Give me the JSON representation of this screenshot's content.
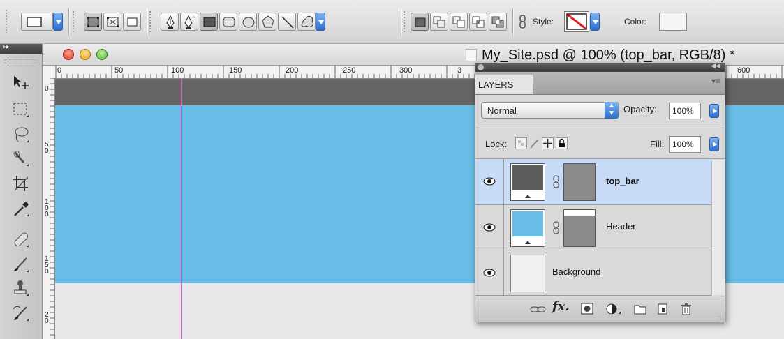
{
  "options_bar": {
    "style_label": "Style:",
    "color_label": "Color:",
    "icons": [
      "rectangle-tool-preset",
      "shape-layers-mode",
      "paths-mode",
      "fill-pixels-mode",
      "pen-tool",
      "freeform-pen-tool",
      "rectangle-shape",
      "rounded-rectangle-shape",
      "ellipse-shape",
      "polygon-shape",
      "line-shape",
      "custom-shape",
      "new-layer",
      "add-to-shape",
      "subtract-shape",
      "intersect-shape",
      "exclude-shape",
      "link-style",
      "style-none-swatch",
      "color-swatch"
    ]
  },
  "tools": [
    "move-tool",
    "marquee-tool",
    "lasso-tool",
    "quick-selection-tool",
    "crop-tool",
    "eyedropper-tool",
    "healing-brush-tool",
    "brush-tool",
    "clone-stamp-tool",
    "history-brush-tool"
  ],
  "document": {
    "title": "My_Site.psd @ 100% (top_bar, RGB/8) *",
    "top_ruler": [
      "0",
      "50",
      "100",
      "150",
      "200",
      "250",
      "300",
      "3",
      "600"
    ],
    "left_ruler": [
      "0",
      "5\n0",
      "1\n0\n0",
      "1\n5\n0",
      "2\n0"
    ],
    "colors": {
      "top_bar": "#646464",
      "header": "#67bde6",
      "guide": "#e04fe0"
    }
  },
  "layers_panel": {
    "tab": "LAYERS",
    "blend_mode": "Normal",
    "opacity_label": "Opacity:",
    "opacity_value": "100%",
    "lock_label": "Lock:",
    "fill_label": "Fill:",
    "fill_value": "100%",
    "layers": [
      {
        "name": "top_bar",
        "selected": true,
        "color": "#5d5d5d"
      },
      {
        "name": "Header",
        "selected": false,
        "color": "#67bde6"
      },
      {
        "name": "Background",
        "selected": false,
        "color": "#f0f0f0"
      }
    ],
    "footer_icons": [
      "link-layers",
      "fx",
      "add-mask",
      "adjustment-layer",
      "new-group",
      "new-layer",
      "delete-layer"
    ]
  }
}
